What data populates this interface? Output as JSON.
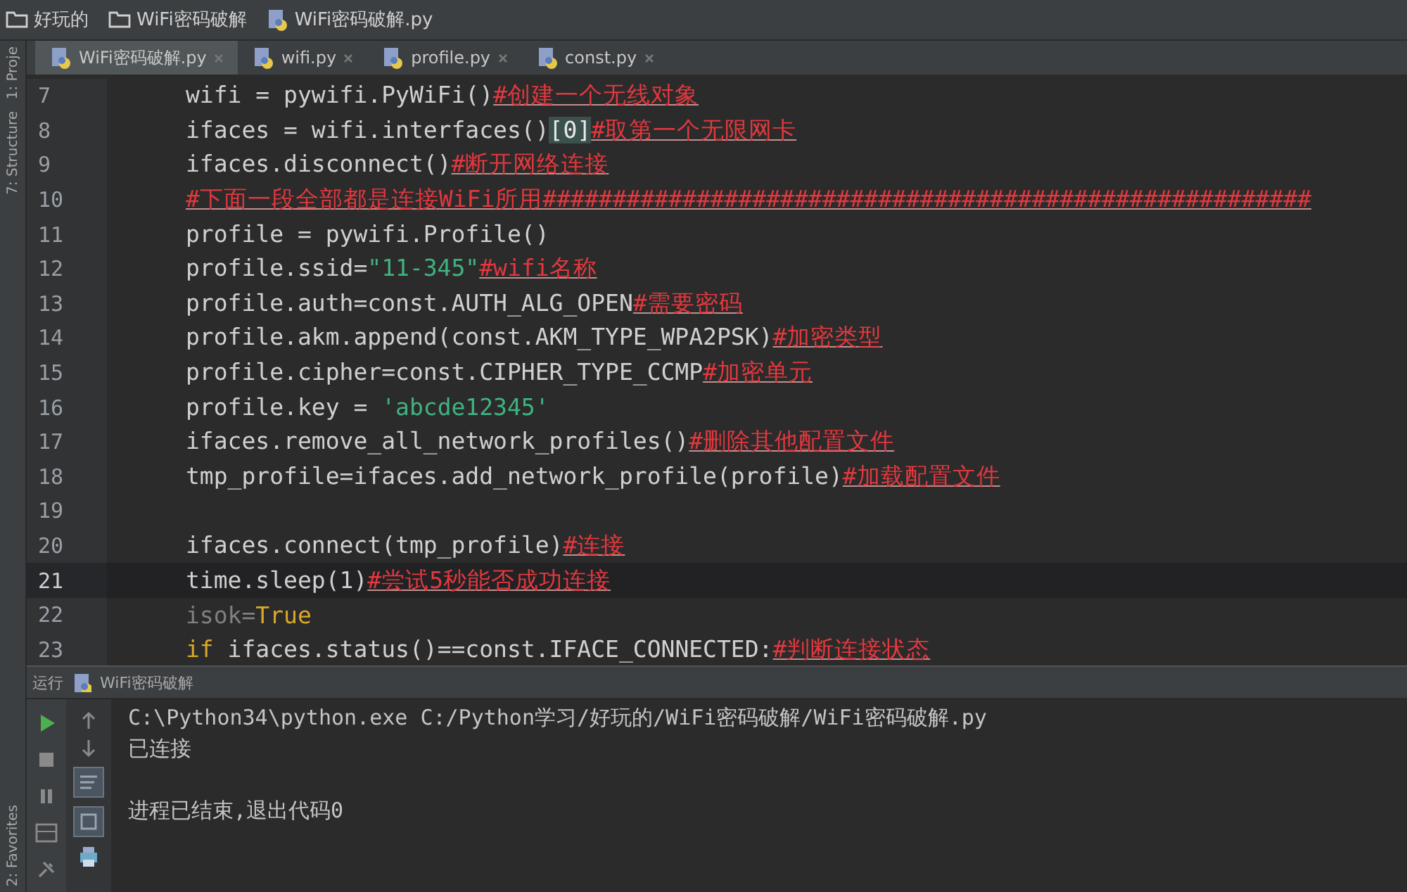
{
  "breadcrumbs": [
    {
      "kind": "folder",
      "label": "好玩的"
    },
    {
      "kind": "folder",
      "label": "WiFi密码破解"
    },
    {
      "kind": "file",
      "label": "WiFi密码破解.py"
    }
  ],
  "side_tools": [
    {
      "label": "1: Proje"
    },
    {
      "label": "7: Structure"
    }
  ],
  "tabs": [
    {
      "label": "WiFi密码破解.py",
      "selected": true
    },
    {
      "label": "wifi.py",
      "selected": false
    },
    {
      "label": "profile.py",
      "selected": false
    },
    {
      "label": "const.py",
      "selected": false
    }
  ],
  "code_lines": [
    {
      "number": "7",
      "current": false,
      "segments": [
        {
          "kind": "code",
          "text": "wifi = pywifi.PyWiFi()"
        },
        {
          "kind": "comment",
          "text": "#创建一个无线对象"
        }
      ]
    },
    {
      "number": "8",
      "current": false,
      "segments": [
        {
          "kind": "code",
          "text": "ifaces = wifi.interfaces()"
        },
        {
          "kind": "bracket",
          "text": "[0]"
        },
        {
          "kind": "comment",
          "text": "#取第一个无限网卡"
        }
      ]
    },
    {
      "number": "9",
      "current": false,
      "segments": [
        {
          "kind": "code",
          "text": "ifaces.disconnect()"
        },
        {
          "kind": "comment",
          "text": "#断开网络连接"
        }
      ]
    },
    {
      "number": "10",
      "current": false,
      "segments": [
        {
          "kind": "comment",
          "text": "#下面一段全部都是连接WiFi所用#######################################################"
        }
      ]
    },
    {
      "number": "11",
      "current": false,
      "segments": [
        {
          "kind": "code",
          "text": "profile = pywifi.Profile()"
        }
      ]
    },
    {
      "number": "12",
      "current": false,
      "segments": [
        {
          "kind": "code",
          "text": "profile.ssid="
        },
        {
          "kind": "string",
          "text": "\"11-345\""
        },
        {
          "kind": "comment",
          "text": "#wifi名称"
        }
      ]
    },
    {
      "number": "13",
      "current": false,
      "segments": [
        {
          "kind": "code",
          "text": "profile.auth=const.AUTH_ALG_OPEN"
        },
        {
          "kind": "comment",
          "text": "#需要密码"
        }
      ]
    },
    {
      "number": "14",
      "current": false,
      "segments": [
        {
          "kind": "code",
          "text": "profile.akm.append(const.AKM_TYPE_WPA2PSK)"
        },
        {
          "kind": "comment",
          "text": "#加密类型"
        }
      ]
    },
    {
      "number": "15",
      "current": false,
      "segments": [
        {
          "kind": "code",
          "text": "profile.cipher=const.CIPHER_TYPE_CCMP"
        },
        {
          "kind": "comment",
          "text": "#加密单元"
        }
      ]
    },
    {
      "number": "16",
      "current": false,
      "segments": [
        {
          "kind": "code",
          "text": "profile.key = "
        },
        {
          "kind": "string",
          "text": "'abcde12345'"
        }
      ]
    },
    {
      "number": "17",
      "current": false,
      "segments": [
        {
          "kind": "code",
          "text": "ifaces.remove_all_network_profiles()"
        },
        {
          "kind": "comment",
          "text": "#删除其他配置文件"
        }
      ]
    },
    {
      "number": "18",
      "current": false,
      "segments": [
        {
          "kind": "code",
          "text": "tmp_profile=ifaces.add_network_profile(profile)"
        },
        {
          "kind": "comment",
          "text": "#加载配置文件"
        }
      ]
    },
    {
      "number": "19",
      "current": false
    },
    {
      "number": "20",
      "current": false,
      "segments": [
        {
          "kind": "code",
          "text": "ifaces.connect(tmp_profile)"
        },
        {
          "kind": "comment",
          "text": "#连接"
        }
      ]
    },
    {
      "number": "21",
      "current": true,
      "segments": [
        {
          "kind": "code",
          "text": "time.sleep(1)"
        },
        {
          "kind": "comment",
          "text": "#尝试5秒能否成功连接"
        }
      ]
    },
    {
      "number": "22",
      "current": false,
      "segments": [
        {
          "kind": "unused",
          "text": "isok="
        },
        {
          "kind": "keyword",
          "text": "True"
        }
      ]
    },
    {
      "number": "23",
      "current": false,
      "segments": [
        {
          "kind": "keyword",
          "text": "if"
        },
        {
          "kind": "code",
          "text": " ifaces.status()==const.IFACE_CONNECTED:"
        },
        {
          "kind": "comment",
          "text": "#判断连接状态"
        }
      ]
    }
  ],
  "run_panel": {
    "title": "运行",
    "config": "WiFi密码破解",
    "output_blocks": [
      [
        "C:\\Python34\\python.exe C:/Python学习/好玩的/WiFi密码破解/WiFi密码破解.py",
        "已连接"
      ],
      [
        "进程已结束,退出代码0"
      ]
    ]
  },
  "bottom_tool": {
    "label": "2: Favorites"
  }
}
